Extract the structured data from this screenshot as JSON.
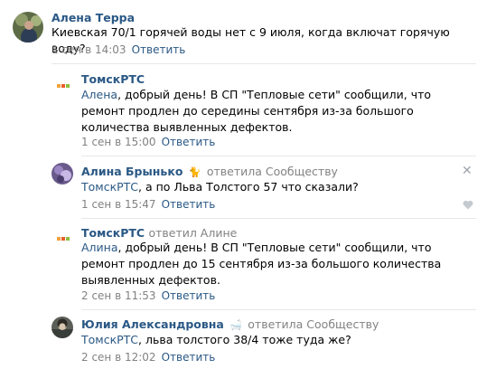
{
  "comments": [
    {
      "author": "Алена Терра",
      "replied": "",
      "address": "",
      "text": "Киевская 70/1 горячей воды нет с 9 июля, когда включат горячую воду?",
      "date": "1 сен в 14:03",
      "reply_label": "Ответить"
    },
    {
      "author": "ТомскРТС",
      "replied": "",
      "address": "Алена",
      "text": ", добрый день! В СП \"Тепловые сети\" сообщили, что ремонт продлен до середины сентября из-за большого количества выявленных дефектов.",
      "date": "1 сен в 15:00",
      "reply_label": "Ответить"
    },
    {
      "author": "Алина Брынько",
      "replied": "ответила Сообществу",
      "address": "ТомскРТС",
      "text": ", а по Льва Толстого 57 что сказали?",
      "date": "1 сен в 15:47",
      "reply_label": "Ответить"
    },
    {
      "author": "ТомскРТС",
      "replied": "ответил Алине",
      "address": "Алина",
      "text": ", добрый день! В СП \"Тепловые сети\" сообщили, что ремонт продлен до 15 сентября из-за большого количества выявленных дефектов.",
      "date": "2 сен в 11:53",
      "reply_label": "Ответить"
    },
    {
      "author": "Юлия Александровна",
      "replied": "ответила Сообществу",
      "address": "ТомскРТС",
      "text": ", льва толстого 38/4 тоже туда же?",
      "date": "2 сен в 12:02",
      "reply_label": "Ответить"
    }
  ],
  "colors": {
    "link": "#2a5885",
    "meta": "#828282",
    "separator": "#e7e8ec"
  },
  "icons": {
    "close": "close-icon",
    "like": "heart-icon"
  }
}
